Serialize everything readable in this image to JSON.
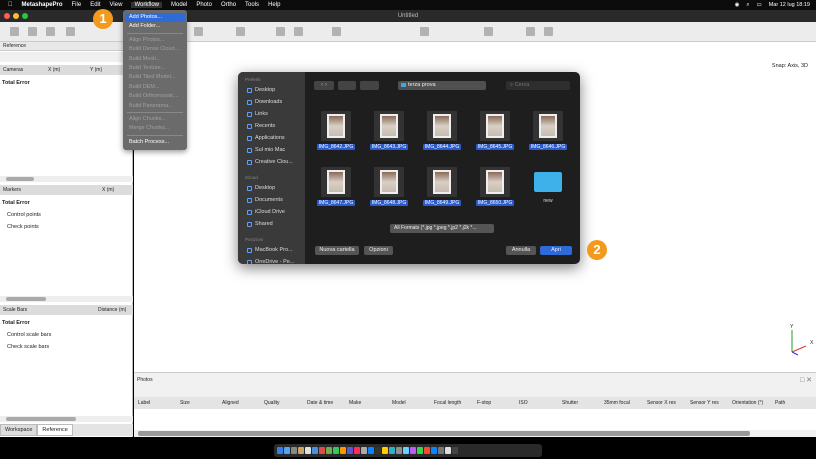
{
  "menubar": {
    "app": "MetashapePro",
    "items": [
      "File",
      "Edit",
      "View",
      "Workflow",
      "Model",
      "Photo",
      "Ortho",
      "Tools",
      "Help"
    ],
    "datetime": "Mar 12 lug  18:19"
  },
  "window": {
    "title": "Untitled"
  },
  "workflow_menu": {
    "items": [
      {
        "label": "Add Photos...",
        "state": "selected"
      },
      {
        "label": "Add Folder...",
        "state": "enabled"
      },
      {
        "label": "Align Photos...",
        "state": "disabled"
      },
      {
        "label": "Build Dense Cloud...",
        "state": "disabled"
      },
      {
        "label": "Build Mesh...",
        "state": "disabled"
      },
      {
        "label": "Build Texture...",
        "state": "disabled"
      },
      {
        "label": "Build Tiled Model...",
        "state": "disabled"
      },
      {
        "label": "Build DEM...",
        "state": "disabled"
      },
      {
        "label": "Build Orthomosaic...",
        "state": "disabled"
      },
      {
        "label": "Build Panorama...",
        "state": "disabled"
      },
      {
        "label": "Align Chunks...",
        "state": "disabled"
      },
      {
        "label": "Merge Chunks...",
        "state": "disabled"
      },
      {
        "label": "Batch Process...",
        "state": "enabled"
      }
    ]
  },
  "reference": {
    "title": "Reference",
    "cameras_cols": [
      "Cameras",
      "X (m)",
      "Y (m)"
    ],
    "total_error": "Total Error",
    "markers_cols": [
      "Markers",
      "X (m)"
    ],
    "markers_rows": [
      "Total Error",
      "Control points",
      "Check points"
    ],
    "scalebars_cols": [
      "Scale Bars",
      "Distance (m)"
    ],
    "scalebars_rows": [
      "Total Error",
      "Control scale bars",
      "Check scale bars"
    ]
  },
  "tabs": [
    "Workspace",
    "Reference"
  ],
  "viewport": {
    "snap": "Snap: Axis, 3D",
    "axis_x": "X",
    "axis_y": "Y"
  },
  "photos": {
    "title": "Photos",
    "columns": [
      "Label",
      "Size",
      "Aligned",
      "Quality",
      "Date & time",
      "Make",
      "Model",
      "Focal length",
      "F-stop",
      "ISO",
      "Shutter",
      "35mm focal",
      "Sensor X res",
      "Sensor Y res",
      "Orientation (°)",
      "Path"
    ]
  },
  "dialog": {
    "location": "terza prova",
    "search_placeholder": "Cerca",
    "sidebar": {
      "favorites_label": "Preferiti",
      "favorites": [
        "Desktop",
        "Downloads",
        "Links",
        "Recents",
        "Applications",
        "Sul mio Mac",
        "Creative Clou..."
      ],
      "icloud_label": "iCloud",
      "icloud": [
        "Desktop",
        "Documents",
        "iCloud Drive",
        "Shared"
      ],
      "locations_label": "Posizioni",
      "locations": [
        "MacBook Pro...",
        "OneDrive - Pe..."
      ]
    },
    "files": [
      "IMG_8642.JPG",
      "IMG_8643.JPG",
      "IMG_8644.JPG",
      "IMG_8645.JPG",
      "IMG_8646.JPG",
      "IMG_8647.JPG",
      "IMG_8648.JPG",
      "IMG_8649.JPG",
      "IMG_8650.JPG"
    ],
    "folder": "new",
    "format": "All Formats (*.jpg *.jpeg *.jp2 *.j2k *...",
    "new_folder": "Nuova cartella",
    "options": "Opzioni",
    "cancel": "Annulla",
    "open": "Apri"
  },
  "steps": [
    "1",
    "2"
  ]
}
